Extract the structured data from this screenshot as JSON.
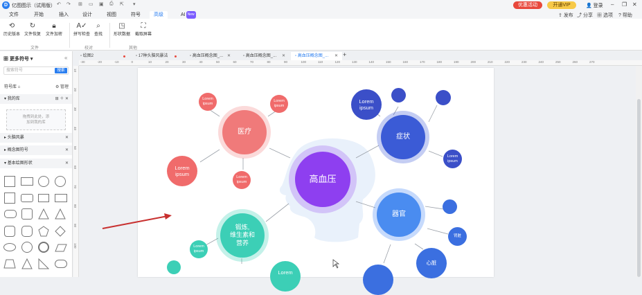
{
  "app": {
    "title": "亿图图示（试用版）",
    "logo": "D"
  },
  "titlebar": {
    "promo": "优惠活动",
    "vip": "开通VIP",
    "login": "登录"
  },
  "menu": {
    "items": [
      "文件",
      "开始",
      "插入",
      "设计",
      "视图",
      "符号",
      "高级",
      "AI"
    ],
    "ai_badge": "New"
  },
  "right_tools": {
    "publish": "发布",
    "share": "分享",
    "select": "选项",
    "help": "帮助"
  },
  "ribbon": {
    "buttons": [
      "历史版本",
      "文件恢复",
      "文件加密",
      "拼写检查",
      "查找",
      "形状数据",
      "截取屏幕"
    ],
    "groups": [
      "文件",
      "校对",
      "其他"
    ]
  },
  "sidebar": {
    "title": "更多符号",
    "search_placeholder": "搜索符号",
    "search_button": "搜索",
    "library_label": "符号库",
    "manage": "管理",
    "my_library": "我的库",
    "empty_hint_1": "拖拽到此处，添",
    "empty_hint_2": "加到我的库",
    "sections": [
      "头脑风暴",
      "概念图符号",
      "基本绘图形状"
    ]
  },
  "tabs": [
    "绘图2",
    "17种头脑风暴法",
    "高血压概念图_...",
    "高血压概念图_...",
    "高血压概念图_..."
  ],
  "ruler_h": [
    "-30",
    "-20",
    "-10",
    "0",
    "10",
    "20",
    "30",
    "40",
    "50",
    "60",
    "70",
    "80",
    "90",
    "100",
    "110",
    "120",
    "130",
    "140",
    "150",
    "160",
    "170",
    "180",
    "190",
    "200",
    "210",
    "220",
    "230",
    "240",
    "250",
    "260",
    "270"
  ],
  "ruler_v": [
    "10",
    "20",
    "30",
    "40",
    "50",
    "60",
    "70",
    "80",
    "90",
    "100"
  ],
  "diagram": {
    "center": "高血压",
    "medical": "医疗",
    "symptom": "症状",
    "organ": "器官",
    "exercise": "锻炼,\n维生素和\n营养",
    "heart": "心脏",
    "kidney": "肾脏",
    "lorem": "Lorem\nipsum",
    "lorem_short": "Lorem"
  },
  "colors": {
    "accent": "#2a7ef0",
    "purple": "#8e3ff0",
    "red": "#f06b6b",
    "blue": "#3b5bd6",
    "teal": "#3ccfb6",
    "arrow": "#c8302f"
  }
}
